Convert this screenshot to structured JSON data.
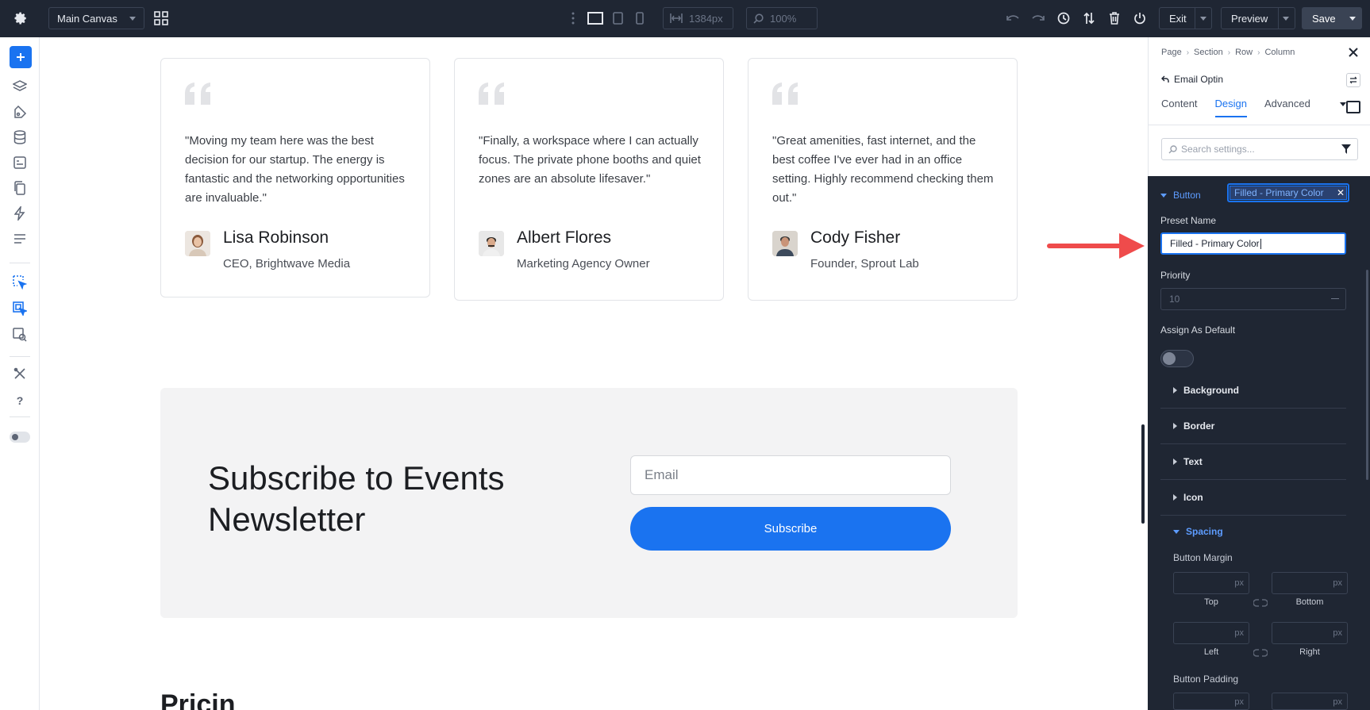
{
  "topbar": {
    "canvas_select": "Main Canvas",
    "width_value": "1384px",
    "zoom_value": "100%",
    "exit_label": "Exit",
    "preview_label": "Preview",
    "save_label": "Save"
  },
  "testimonials": [
    {
      "quote": "\"Moving my team here was the best decision for our startup. The energy is fantastic and the networking opportunities are invaluable.\"",
      "name": "Lisa Robinson",
      "role": "CEO, Brightwave Media"
    },
    {
      "quote": "\"Finally, a workspace where I can actually focus. The private phone booths and quiet zones are an absolute lifesaver.\"",
      "name": "Albert Flores",
      "role": "Marketing Agency Owner"
    },
    {
      "quote": "\"Great amenities, fast internet, and the best coffee I've ever had in an office setting. Highly recommend checking them out.\"",
      "name": "Cody Fisher",
      "role": "Founder, Sprout Lab"
    }
  ],
  "subscribe": {
    "title": "Subscribe to Events Newsletter",
    "email_placeholder": "Email",
    "button_label": "Subscribe"
  },
  "next_section_heading_partial": "Pricin",
  "panel": {
    "breadcrumbs": [
      "Page",
      "Section",
      "Row",
      "Column"
    ],
    "module_title": "Email Optin",
    "tabs": [
      "Content",
      "Design",
      "Advanced"
    ],
    "active_tab": "Design",
    "search_placeholder": "Search settings...",
    "button_section": "Button",
    "preset_chip": "Filled - Primary Color",
    "preset_name_label": "Preset Name",
    "preset_name_value": "Filled - Primary Color",
    "priority_label": "Priority",
    "priority_placeholder": "10",
    "assign_default_label": "Assign As Default",
    "assign_default_on": false,
    "accordions": [
      "Background",
      "Border",
      "Text",
      "Icon"
    ],
    "spacing_label": "Spacing",
    "button_margin_label": "Button Margin",
    "unit": "px",
    "margin_captions": [
      "Top",
      "Bottom",
      "Left",
      "Right"
    ],
    "button_padding_label": "Button Padding"
  },
  "colors": {
    "accent": "#1a73f0",
    "dark_chrome": "#1f2633",
    "annotation_arrow": "#ef4b4b"
  }
}
